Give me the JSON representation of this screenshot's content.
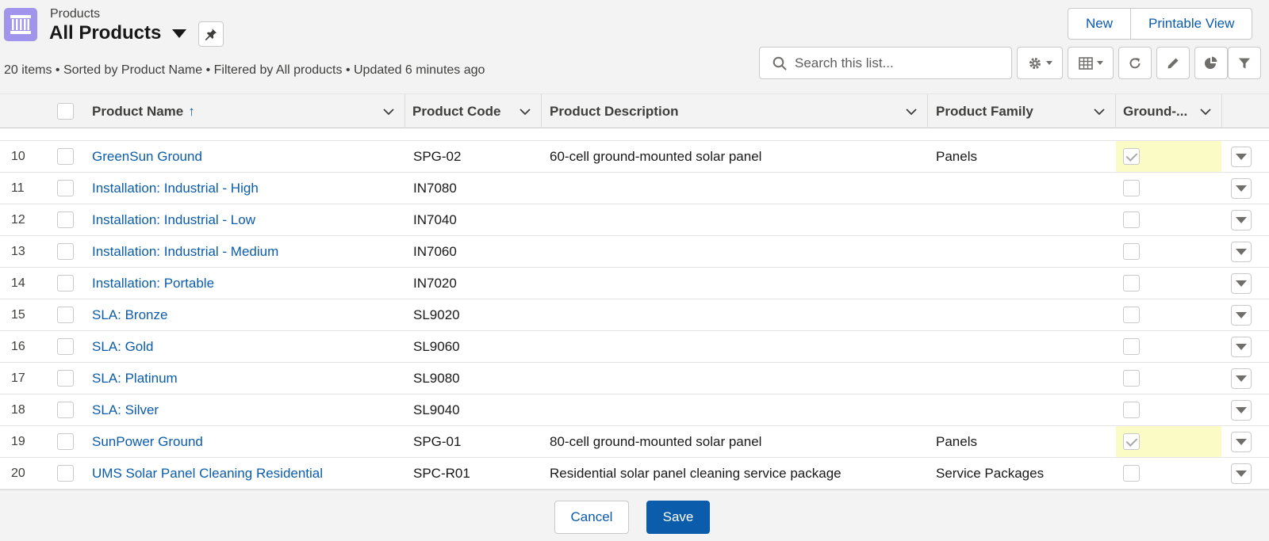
{
  "header": {
    "object_label": "Products",
    "list_title": "All Products",
    "meta": "20 items • Sorted by Product Name • Filtered by All products • Updated 6 minutes ago",
    "buttons": {
      "new": "New",
      "printable": "Printable View"
    },
    "search_placeholder": "Search this list...",
    "object_icon": "product-icon",
    "accent": "#a094ed"
  },
  "table": {
    "columns": {
      "name": "Product Name",
      "code": "Product Code",
      "description": "Product Description",
      "family": "Product Family",
      "ground": "Ground-..."
    },
    "sort_indicator": "↑",
    "rows": [
      {
        "num": "10",
        "name": "GreenSun Ground",
        "code": "SPG-02",
        "description": "60-cell ground-mounted solar panel",
        "family": "Panels",
        "ground": true
      },
      {
        "num": "11",
        "name": "Installation: Industrial - High",
        "code": "IN7080",
        "description": "",
        "family": "",
        "ground": false
      },
      {
        "num": "12",
        "name": "Installation: Industrial - Low",
        "code": "IN7040",
        "description": "",
        "family": "",
        "ground": false
      },
      {
        "num": "13",
        "name": "Installation: Industrial - Medium",
        "code": "IN7060",
        "description": "",
        "family": "",
        "ground": false
      },
      {
        "num": "14",
        "name": "Installation: Portable",
        "code": "IN7020",
        "description": "",
        "family": "",
        "ground": false
      },
      {
        "num": "15",
        "name": "SLA: Bronze",
        "code": "SL9020",
        "description": "",
        "family": "",
        "ground": false
      },
      {
        "num": "16",
        "name": "SLA: Gold",
        "code": "SL9060",
        "description": "",
        "family": "",
        "ground": false
      },
      {
        "num": "17",
        "name": "SLA: Platinum",
        "code": "SL9080",
        "description": "",
        "family": "",
        "ground": false
      },
      {
        "num": "18",
        "name": "SLA: Silver",
        "code": "SL9040",
        "description": "",
        "family": "",
        "ground": false
      },
      {
        "num": "19",
        "name": "SunPower Ground",
        "code": "SPG-01",
        "description": "80-cell ground-mounted solar panel",
        "family": "Panels",
        "ground": true
      },
      {
        "num": "20",
        "name": "UMS Solar Panel Cleaning Residential",
        "code": "SPC-R01",
        "description": "Residential solar panel cleaning service package",
        "family": "Service Packages",
        "ground": false
      }
    ]
  },
  "footer": {
    "cancel": "Cancel",
    "save": "Save"
  },
  "colors": {
    "link": "#0b5cab",
    "highlight": "#fbfbc6",
    "save_bg": "#0b5cab"
  }
}
